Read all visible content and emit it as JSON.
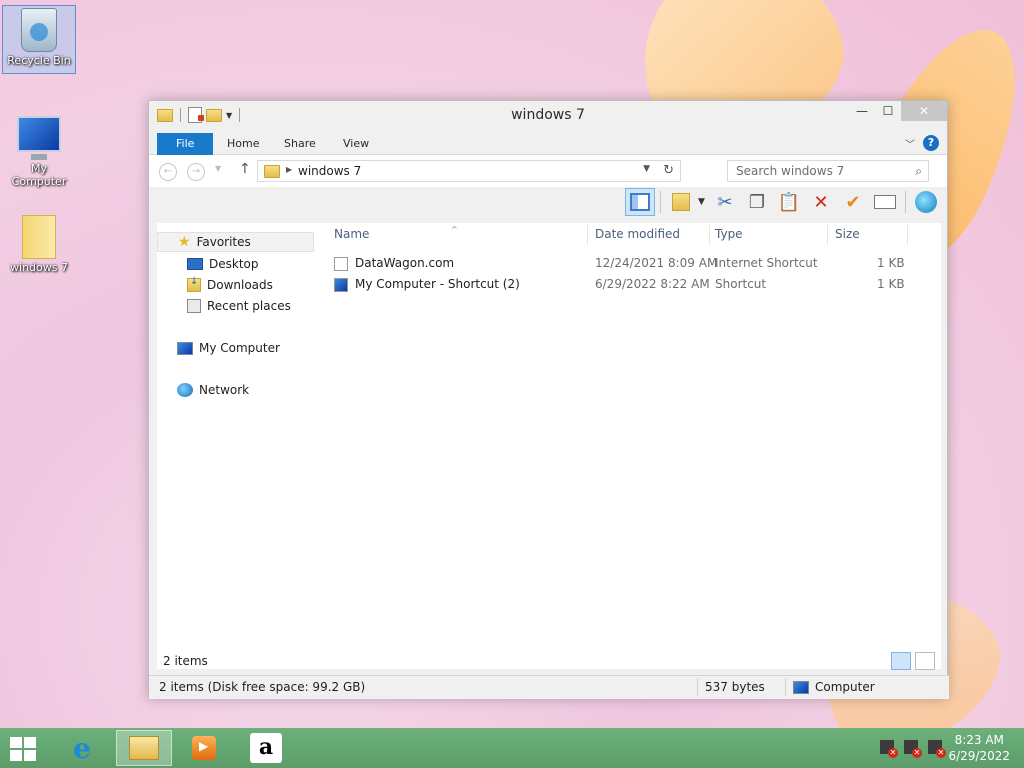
{
  "desktop": {
    "icons": [
      {
        "label": "Recycle Bin"
      },
      {
        "label": "My Computer"
      },
      {
        "label": "windows 7"
      }
    ]
  },
  "window": {
    "title": "windows 7",
    "controls": {
      "minimize": "—",
      "maximize": "☐",
      "close": "✕"
    },
    "ribbon_tabs": [
      "File",
      "Home",
      "Share",
      "View"
    ],
    "help": "?",
    "address": {
      "crumb": "windows 7"
    },
    "search": {
      "placeholder": "Search windows 7"
    },
    "nav": {
      "favorites": "Favorites",
      "desktop": "Desktop",
      "downloads": "Downloads",
      "recent": "Recent places",
      "computer": "My Computer",
      "network": "Network"
    },
    "columns": {
      "name": "Name",
      "date": "Date modified",
      "type": "Type",
      "size": "Size"
    },
    "files": [
      {
        "name": "DataWagon.com",
        "date": "12/24/2021 8:09 AM",
        "type": "Internet Shortcut",
        "size": "1 KB"
      },
      {
        "name": "My Computer - Shortcut (2)",
        "date": "6/29/2022 8:22 AM",
        "type": "Shortcut",
        "size": "1 KB"
      }
    ],
    "item_count": "2 items",
    "status": {
      "left": "2 items (Disk free space: 99.2 GB)",
      "size": "537 bytes",
      "location": "Computer"
    }
  },
  "taskbar": {
    "time": "8:23 AM",
    "date": "6/29/2022",
    "amazon_glyph": "a",
    "ie_glyph": "e"
  }
}
